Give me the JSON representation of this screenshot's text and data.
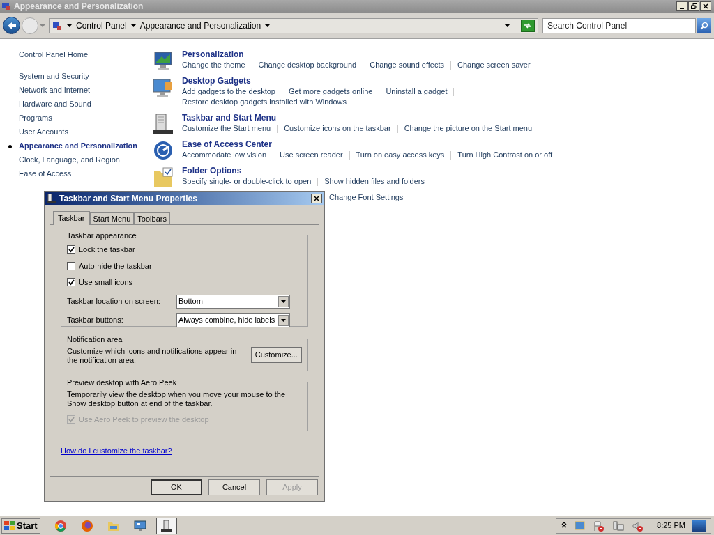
{
  "window": {
    "title": "Appearance and Personalization"
  },
  "address_bar": {
    "breadcrumb": [
      "Control Panel",
      "Appearance and Personalization"
    ],
    "search": {
      "placeholder": "Search Control Panel"
    }
  },
  "sidebar": {
    "home": "Control Panel Home",
    "items": [
      {
        "label": "System and Security",
        "selected": false
      },
      {
        "label": "Network and Internet",
        "selected": false
      },
      {
        "label": "Hardware and Sound",
        "selected": false
      },
      {
        "label": "Programs",
        "selected": false
      },
      {
        "label": "User Accounts",
        "selected": false
      },
      {
        "label": "Appearance and Personalization",
        "selected": true
      },
      {
        "label": "Clock, Language, and Region",
        "selected": false
      },
      {
        "label": "Ease of Access",
        "selected": false
      }
    ]
  },
  "categories": [
    {
      "kind": "personalization",
      "title": "Personalization",
      "lines": [
        [
          "Change the theme",
          "Change desktop background",
          "Change sound effects",
          "Change screen saver"
        ]
      ]
    },
    {
      "kind": "gadgets",
      "title": "Desktop Gadgets",
      "lines": [
        [
          "Add gadgets to the desktop",
          "Get more gadgets online",
          "Uninstall a gadget"
        ],
        [
          "Restore desktop gadgets installed with Windows"
        ]
      ]
    },
    {
      "kind": "taskbar",
      "title": "Taskbar and Start Menu",
      "lines": [
        [
          "Customize the Start menu",
          "Customize icons on the taskbar",
          "Change the picture on the Start menu"
        ]
      ]
    },
    {
      "kind": "access",
      "title": "Ease of Access Center",
      "lines": [
        [
          "Accommodate low vision",
          "Use screen reader",
          "Turn on easy access keys",
          "Turn High Contrast on or off"
        ]
      ]
    },
    {
      "kind": "folder",
      "title": "Folder Options",
      "lines": [
        [
          "Specify single- or double-click to open",
          "Show hidden files and folders"
        ]
      ]
    },
    {
      "kind": "hidden",
      "lines": [
        [
          "Change Font Settings"
        ]
      ]
    }
  ],
  "dialog": {
    "title": "Taskbar and Start Menu Properties",
    "tabs": [
      {
        "label": "Taskbar",
        "selected": true
      },
      {
        "label": "Start Menu",
        "selected": false
      },
      {
        "label": "Toolbars",
        "selected": false
      }
    ],
    "appearance": {
      "title": "Taskbar appearance",
      "checkboxes": [
        {
          "label": "Lock the taskbar",
          "checked": true,
          "disabled": false
        },
        {
          "label": "Auto-hide the taskbar",
          "checked": false,
          "disabled": false
        },
        {
          "label": "Use small icons",
          "checked": true,
          "disabled": false
        }
      ],
      "selects": [
        {
          "label": "Taskbar location on screen:",
          "value": "Bottom"
        },
        {
          "label": "Taskbar buttons:",
          "value": "Always combine, hide labels"
        }
      ]
    },
    "notification": {
      "title": "Notification area",
      "text": "Customize which icons and notifications appear in the notification area.",
      "button": "Customize..."
    },
    "peek": {
      "title": "Preview desktop with Aero Peek",
      "text": "Temporarily view the desktop when you move your mouse to the Show desktop button at end of the taskbar.",
      "checkbox": {
        "label": "Use Aero Peek to preview the desktop",
        "checked": true,
        "disabled": true
      }
    },
    "help_link": "How do I customize the taskbar?",
    "buttons": [
      {
        "label": "OK",
        "default": true,
        "disabled": false
      },
      {
        "label": "Cancel",
        "default": false,
        "disabled": false
      },
      {
        "label": "Apply",
        "default": false,
        "disabled": true
      }
    ]
  },
  "taskbar": {
    "start": "Start",
    "apps": [
      {
        "kind": "chrome",
        "active": false
      },
      {
        "kind": "firefox",
        "active": false
      },
      {
        "kind": "explorer",
        "active": false
      },
      {
        "kind": "remote",
        "active": false
      },
      {
        "kind": "taskbar-props",
        "active": true
      }
    ],
    "time": "8:25 PM"
  }
}
